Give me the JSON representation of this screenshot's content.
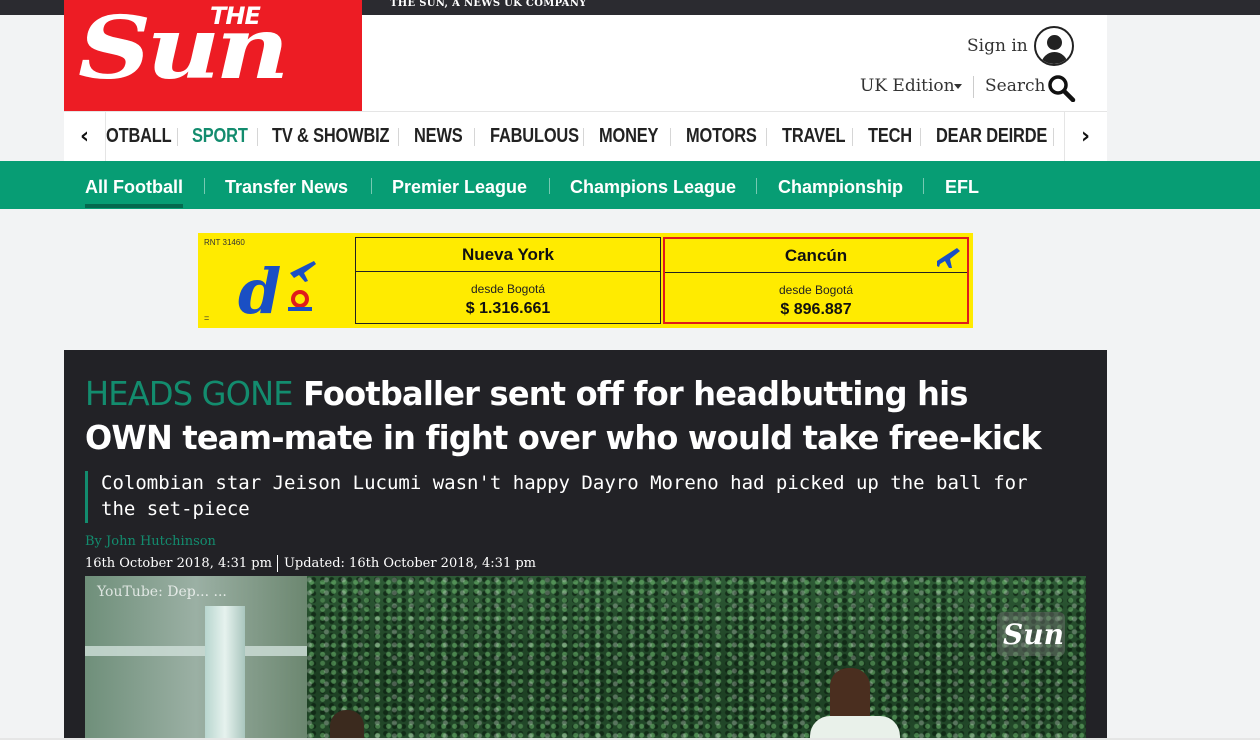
{
  "topbar": {
    "company": "THE SUN, A NEWS UK COMPANY"
  },
  "logo": {
    "the": "THE",
    "sun": "Sun"
  },
  "account": {
    "signin": "Sign in",
    "edition": "UK Edition",
    "search": "Search"
  },
  "nav": {
    "items": [
      "OTBALL",
      "SPORT",
      "TV & SHOWBIZ",
      "NEWS",
      "FABULOUS",
      "MONEY",
      "MOTORS",
      "TRAVEL",
      "TECH",
      "DEAR DEIRDE"
    ],
    "active": "SPORT",
    "left_arrow": "‹",
    "right_arrow": "›"
  },
  "subnav": {
    "items": [
      "All Football",
      "Transfer News",
      "Premier League",
      "Champions League",
      "Championship",
      "EFL"
    ],
    "active": "All Football"
  },
  "ad": {
    "rnt": "RNT 31460",
    "eq": "=",
    "offers": [
      {
        "city": "Nueva York",
        "from": "desde Bogotá",
        "price": "$ 1.316.661"
      },
      {
        "city": "Cancún",
        "from": "desde Bogotá",
        "price": "$ 896.887"
      }
    ],
    "colors": {
      "background": "#ffeb00",
      "selected_border": "#e01b1b",
      "plane": "#1a4fc4"
    }
  },
  "article": {
    "kicker": "HEADS GONE",
    "headline": "Footballer sent off for headbutting his OWN team-mate in fight over who would take free-kick",
    "standfirst": "Colombian star Jeison Lucumi wasn't happy Dayro Moreno had picked up the ball for the set-piece",
    "byline": "By John Hutchinson",
    "published": "16th October 2018, 4:31 pm",
    "updated": "Updated: 16th October 2018, 4:31 pm",
    "video_label": "YouTube: Dep... ...",
    "watermark": "Sun"
  },
  "colors": {
    "brand_red": "#ed1c24",
    "sport_green": "#079d74",
    "kicker_green": "#138c6e",
    "article_bg": "#222226"
  }
}
